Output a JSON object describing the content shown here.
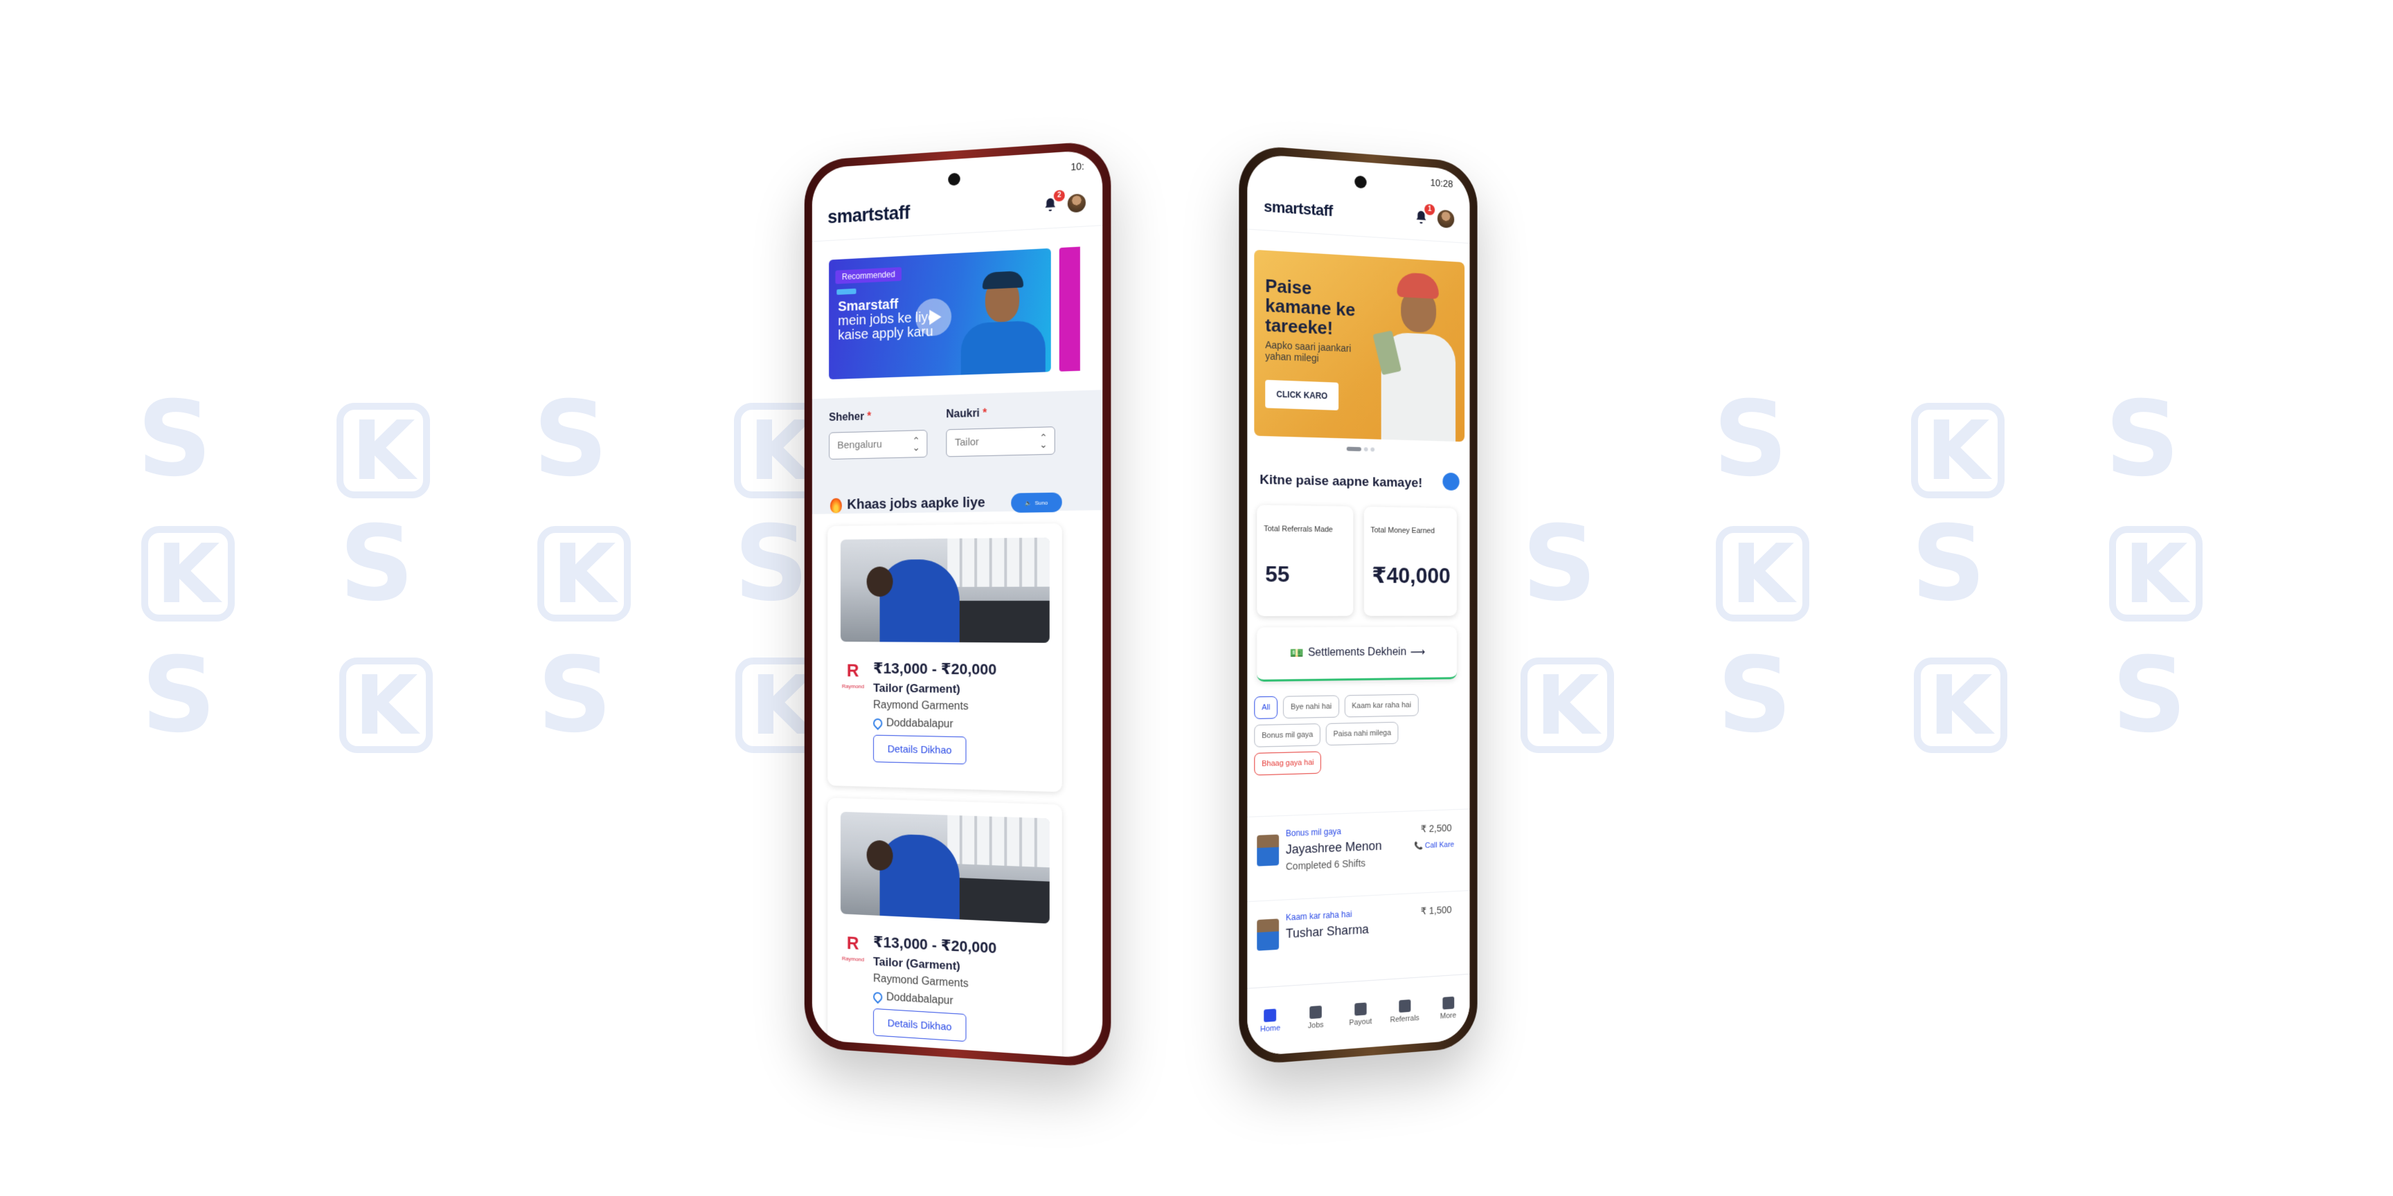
{
  "left_phone": {
    "status_time": "10:",
    "header": {
      "logo": "smartstaff",
      "notif_count": "2"
    },
    "banner": {
      "tag": "Recommended",
      "title": "Smarstaff",
      "subtitle": "mein jobs ke liye kaise apply karu"
    },
    "filters": {
      "city_label": "Sheher",
      "city_value": "Bengaluru",
      "job_label": "Naukri",
      "job_value": "Tailor",
      "required_mark": "*"
    },
    "section": {
      "title": "Khaas jobs aapke liye",
      "listen_label": "Suno"
    },
    "jobs": [
      {
        "salary": "₹13,000 - ₹20,000",
        "role": "Tailor (Garment)",
        "company": "Raymond Garments",
        "location": "Doddabalapur",
        "button": "Details Dikhao",
        "company_logo": "R",
        "company_logo_sub": "Raymond"
      },
      {
        "salary": "₹13,000 - ₹20,000",
        "role": "Tailor (Garment)",
        "company": "Raymond Garments",
        "location": "Doddabalapur",
        "button": "Details Dikhao",
        "company_logo": "R",
        "company_logo_sub": "Raymond"
      }
    ]
  },
  "right_phone": {
    "status_time": "10:28",
    "header": {
      "logo": "smartstaff",
      "notif_count": "1"
    },
    "banner": {
      "title": "Paise kamane ke tareeke!",
      "subtitle": "Aapko saari jaankari yahan milegi",
      "button": "CLICK KARO"
    },
    "earnings": {
      "title": "Kitne paise aapne kamaye!",
      "stats": [
        {
          "label": "Total Referrals Made",
          "value": "55"
        },
        {
          "label": "Total Money Earned",
          "value": "₹40,000"
        }
      ],
      "settlement_button": "Settlements Dekhein",
      "settlement_arrow": "⟶"
    },
    "chips": [
      {
        "label": "All",
        "state": "active"
      },
      {
        "label": "Bye nahi hai",
        "state": "normal"
      },
      {
        "label": "Kaam kar raha hai",
        "state": "normal"
      },
      {
        "label": "Bonus mil gaya",
        "state": "normal"
      },
      {
        "label": "Paisa nahi milega",
        "state": "normal"
      },
      {
        "label": "Bhaag gaya hai",
        "state": "red"
      }
    ],
    "referrals": [
      {
        "status": "Bonus mil gaya",
        "name": "Jayashree Menon",
        "shifts": "Completed 6 Shifts",
        "amount": "₹ 2,500",
        "call": "Call Kare"
      },
      {
        "status": "Kaam kar raha hai",
        "name": "Tushar Sharma",
        "shifts": "",
        "amount": "₹ 1,500",
        "call": ""
      }
    ],
    "nav": [
      {
        "label": "Home",
        "icon": "home-icon",
        "active": true
      },
      {
        "label": "Jobs",
        "icon": "jobs-icon",
        "active": false
      },
      {
        "label": "Payout",
        "icon": "payout-icon",
        "active": false
      },
      {
        "label": "Referrals",
        "icon": "referrals-icon",
        "active": false
      },
      {
        "label": "More",
        "icon": "more-icon",
        "active": false
      }
    ]
  },
  "colors": {
    "primary": "#2b4be6",
    "accent_blue": "#2b7be6",
    "required": "#e53935",
    "success": "#2fbf71",
    "banner_orange": "#e8a53a"
  }
}
